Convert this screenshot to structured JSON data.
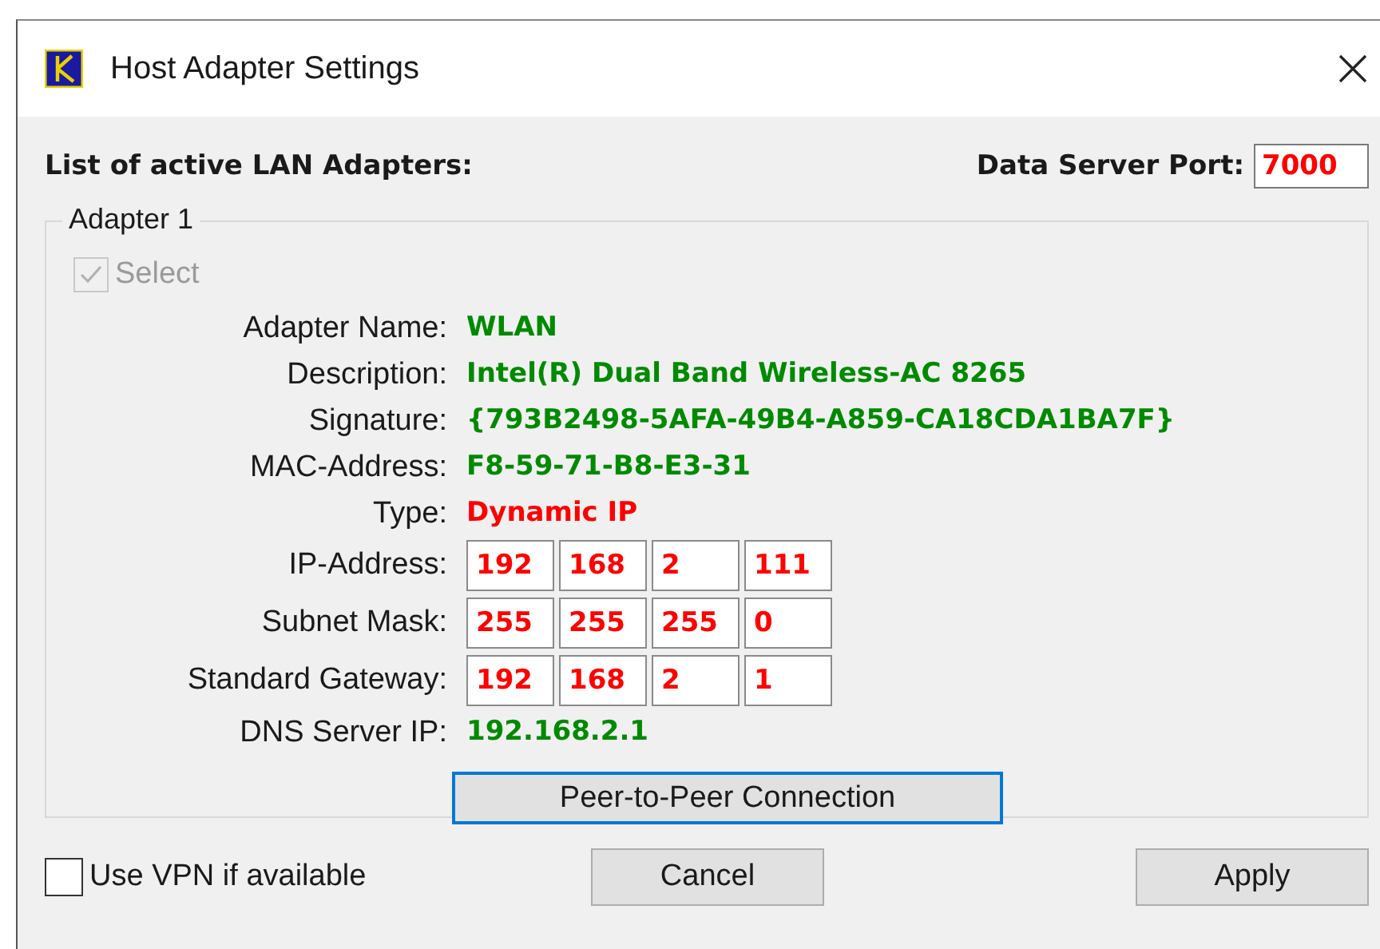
{
  "window": {
    "title": "Host Adapter Settings"
  },
  "header": {
    "list_label": "List of active LAN Adapters:",
    "port_label": "Data Server Port:",
    "port_value": "7000"
  },
  "adapter": {
    "legend": "Adapter 1",
    "select": {
      "label": "Select",
      "checked": true,
      "disabled": true
    },
    "rows": [
      {
        "kind": "text",
        "label": "Adapter Name:",
        "value": "WLAN",
        "color": "#008a00"
      },
      {
        "kind": "text",
        "label": "Description:",
        "value": "Intel(R) Dual Band Wireless-AC 8265",
        "color": "#008a00"
      },
      {
        "kind": "text",
        "label": "Signature:",
        "value": "{793B2498-5AFA-49B4-A859-CA18CDA1BA7F}",
        "color": "#008a00"
      },
      {
        "kind": "text",
        "label": "MAC-Address:",
        "value": "F8-59-71-B8-E3-31",
        "color": "#008a00"
      },
      {
        "kind": "text",
        "label": "Type:",
        "value": "Dynamic IP",
        "color": "#ff0000"
      },
      {
        "kind": "octets",
        "label": "IP-Address:",
        "octets": [
          "192",
          "168",
          "2",
          "111"
        ]
      },
      {
        "kind": "octets",
        "label": "Subnet Mask:",
        "octets": [
          "255",
          "255",
          "255",
          "0"
        ]
      },
      {
        "kind": "octets",
        "label": "Standard Gateway:",
        "octets": [
          "192",
          "168",
          "2",
          "1"
        ]
      },
      {
        "kind": "text",
        "label": "DNS Server IP:",
        "value": "192.168.2.1",
        "color": "#008a00"
      }
    ],
    "peer_button": {
      "label": "Peer-to-Peer Connection",
      "focused": true
    }
  },
  "footer": {
    "vpn": {
      "label": "Use VPN if available",
      "checked": false
    },
    "buttons": [
      "Cancel",
      "Apply"
    ]
  }
}
